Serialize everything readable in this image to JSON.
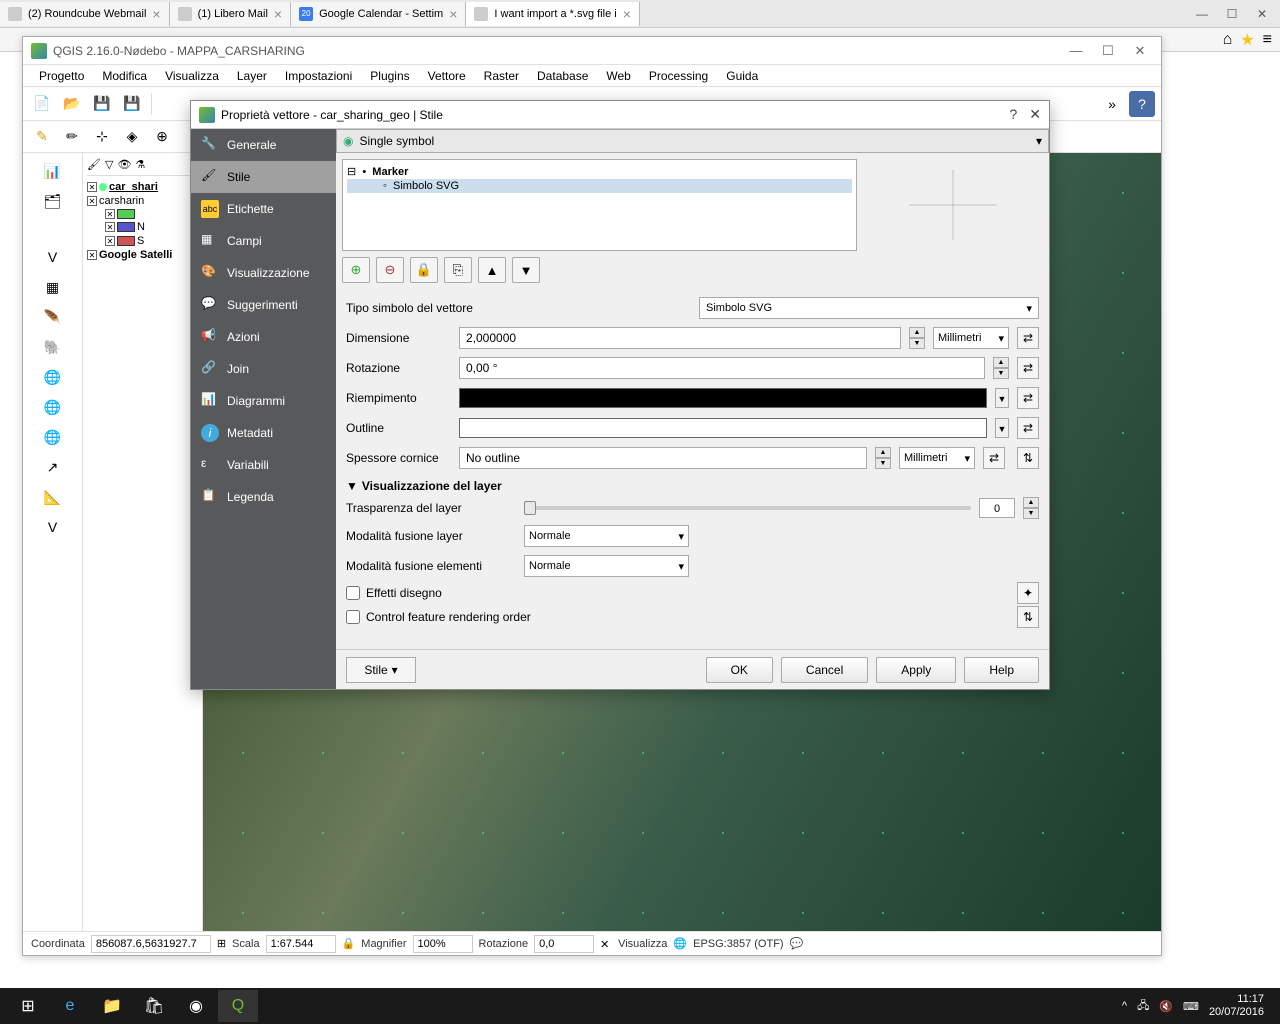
{
  "browser": {
    "tabs": [
      {
        "label": "(2) Roundcube Webmail",
        "active": false
      },
      {
        "label": "(1) Libero Mail",
        "active": false
      },
      {
        "label": "Google Calendar - Settim",
        "active": false,
        "badge": "20"
      },
      {
        "label": "I want import a *.svg file i",
        "active": true
      }
    ]
  },
  "qgis": {
    "title": "QGIS 2.16.0-Nødebo - MAPPA_CARSHARING",
    "menu": [
      "Progetto",
      "Modifica",
      "Visualizza",
      "Layer",
      "Impostazioni",
      "Plugins",
      "Vettore",
      "Raster",
      "Database",
      "Web",
      "Processing",
      "Guida"
    ],
    "layers": {
      "l1": "car_shari",
      "l2": "carsharin",
      "l3": "N",
      "l4": "S",
      "l5": "Google Satelli"
    },
    "status": {
      "coord_label": "Coordinata",
      "coord_value": "856087.6,5631927.7",
      "scale_label": "Scala",
      "scale_value": "1:67.544",
      "mag_label": "Magnifier",
      "mag_value": "100%",
      "rot_label": "Rotazione",
      "rot_value": "0,0",
      "render_label": "Visualizza",
      "crs": "EPSG:3857 (OTF)"
    }
  },
  "dialog": {
    "title": "Proprietà vettore - car_sharing_geo | Stile",
    "sidebar": {
      "generale": "Generale",
      "stile": "Stile",
      "etichette": "Etichette",
      "campi": "Campi",
      "visualizzazione": "Visualizzazione",
      "suggerimenti": "Suggerimenti",
      "azioni": "Azioni",
      "join": "Join",
      "diagrammi": "Diagrammi",
      "metadati": "Metadati",
      "variabili": "Variabili",
      "legenda": "Legenda"
    },
    "single_symbol": "Single symbol",
    "tree": {
      "marker": "Marker",
      "svg": "Simbolo SVG"
    },
    "form": {
      "tipo_label": "Tipo simbolo del vettore",
      "tipo_value": "Simbolo SVG",
      "dim_label": "Dimensione",
      "dim_value": "2,000000",
      "dim_unit": "Millimetri",
      "rot_label": "Rotazione",
      "rot_value": "0,00 °",
      "fill_label": "Riempimento",
      "outline_label": "Outline",
      "thick_label": "Spessore cornice",
      "thick_value": "No outline",
      "thick_unit": "Millimetri"
    },
    "vis": {
      "header": "Visualizzazione del layer",
      "transparency_label": "Trasparenza del layer",
      "transparency_value": "0",
      "blend_layer_label": "Modalità fusione layer",
      "blend_layer_value": "Normale",
      "blend_elem_label": "Modalità fusione elementi",
      "blend_elem_value": "Normale",
      "effects_label": "Effetti disegno",
      "order_label": "Control feature rendering order"
    },
    "footer": {
      "style": "Stile",
      "ok": "OK",
      "cancel": "Cancel",
      "apply": "Apply",
      "help": "Help"
    }
  },
  "taskbar": {
    "time": "11:17",
    "date": "20/07/2016"
  }
}
